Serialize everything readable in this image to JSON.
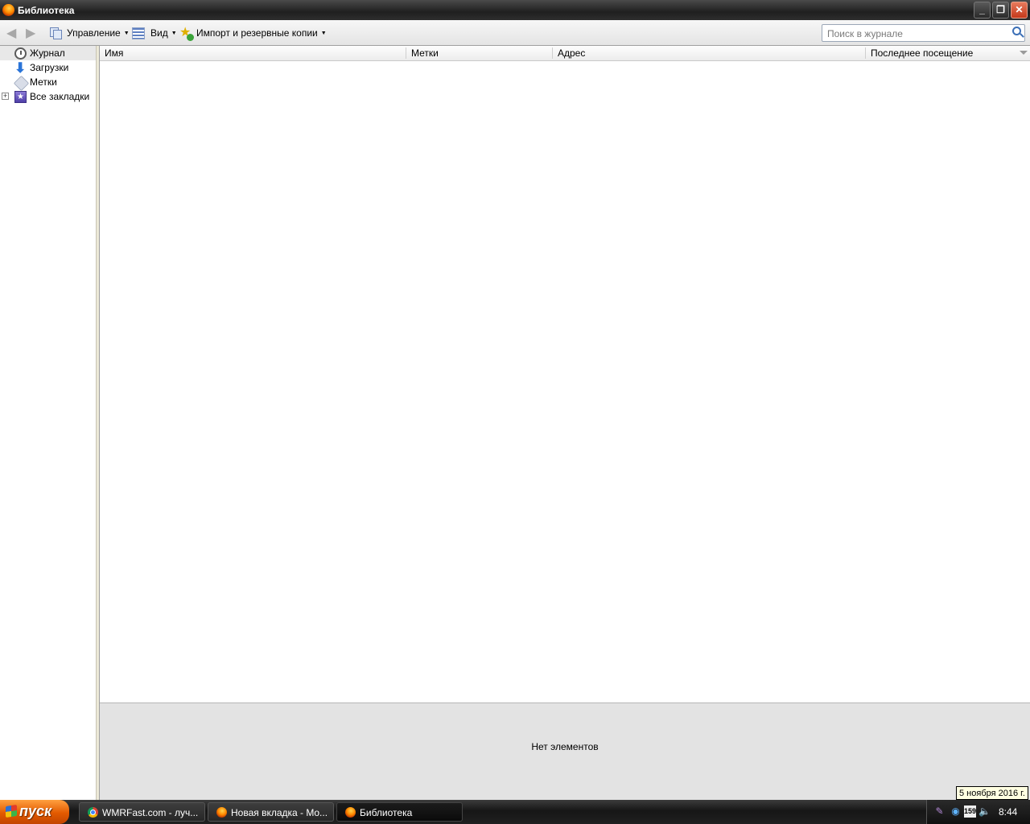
{
  "window": {
    "title": "Библиотека"
  },
  "toolbar": {
    "back_icon": "back-arrow-icon",
    "forward_icon": "forward-arrow-icon",
    "manage_label": "Управление",
    "view_label": "Вид",
    "import_label": "Импорт и резервные копии"
  },
  "search": {
    "placeholder": "Поиск в журнале",
    "value": ""
  },
  "sidebar": {
    "items": [
      {
        "label": "Журнал",
        "icon": "clock-icon",
        "selected": true
      },
      {
        "label": "Загрузки",
        "icon": "download-arrow-icon",
        "selected": false
      },
      {
        "label": "Метки",
        "icon": "tag-icon",
        "selected": false
      },
      {
        "label": "Все закладки",
        "icon": "bookmarks-star-icon",
        "selected": false,
        "expander": "+"
      }
    ]
  },
  "table": {
    "columns": [
      "Имя",
      "Метки",
      "Адрес",
      "Последнее посещение"
    ],
    "rows": []
  },
  "details": {
    "empty_text": "Нет элементов"
  },
  "tooltip": {
    "text": "5 ноября 2016 г."
  },
  "taskbar": {
    "start_label": "пуск",
    "tasks": [
      {
        "label": "WMRFast.com - луч...",
        "icon": "chrome-icon",
        "active": false
      },
      {
        "label": "Новая вкладка - Mo...",
        "icon": "firefox-icon",
        "active": false
      },
      {
        "label": "Библиотека",
        "icon": "firefox-icon",
        "active": true
      }
    ],
    "tray_badge": "159",
    "clock": "8:44"
  },
  "colors": {
    "titlebar": "#2e2e2e",
    "start_button": "#e25a00",
    "details_bg": "#e3e3e3",
    "tooltip_bg": "#ffffe1"
  }
}
